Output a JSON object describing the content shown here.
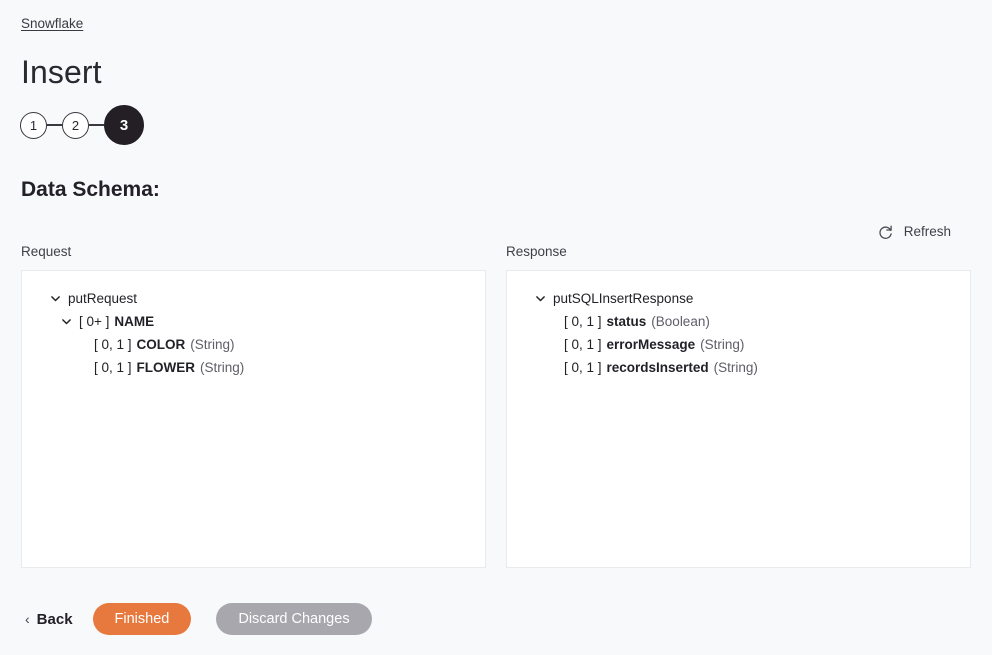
{
  "breadcrumb": {
    "label": "Snowflake"
  },
  "header": {
    "title": "Insert"
  },
  "stepper": {
    "steps": [
      {
        "label": "1",
        "active": false
      },
      {
        "label": "2",
        "active": false
      },
      {
        "label": "3",
        "active": true
      }
    ]
  },
  "section": {
    "heading": "Data Schema:"
  },
  "columns": {
    "request_label": "Request",
    "response_label": "Response"
  },
  "refresh": {
    "label": "Refresh",
    "icon": "refresh-icon"
  },
  "request_tree": {
    "nodes": [
      {
        "depth": 0,
        "chevron": "chevron-down-icon",
        "occurs": "",
        "name": "putRequest",
        "type": "",
        "bold": false
      },
      {
        "depth": 1,
        "chevron": "chevron-down-icon",
        "occurs": "[ 0+ ]",
        "name": "NAME",
        "type": "",
        "bold": true
      },
      {
        "depth": 2,
        "chevron": "",
        "occurs": "[ 0, 1 ]",
        "name": "COLOR",
        "type": "(String)",
        "bold": true
      },
      {
        "depth": 2,
        "chevron": "",
        "occurs": "[ 0, 1 ]",
        "name": "FLOWER",
        "type": "(String)",
        "bold": true
      }
    ]
  },
  "response_tree": {
    "nodes": [
      {
        "depth": 0,
        "chevron": "chevron-down-icon",
        "occurs": "",
        "name": "putSQLInsertResponse",
        "type": "",
        "bold": false
      },
      {
        "depth": 1,
        "chevron": "",
        "occurs": "[ 0, 1 ]",
        "name": "status",
        "type": "(Boolean)",
        "bold": true
      },
      {
        "depth": 1,
        "chevron": "",
        "occurs": "[ 0, 1 ]",
        "name": "errorMessage",
        "type": "(String)",
        "bold": true
      },
      {
        "depth": 1,
        "chevron": "",
        "occurs": "[ 0, 1 ]",
        "name": "recordsInserted",
        "type": "(String)",
        "bold": true
      }
    ]
  },
  "footer": {
    "back_label": "Back",
    "back_chevron": "‹",
    "finished_label": "Finished",
    "discard_label": "Discard Changes"
  },
  "colors": {
    "accent_orange": "#e8793e",
    "neutral_gray": "#a7a7ad",
    "active_step": "#231f25",
    "page_background": "#f8f9fb",
    "panel_background": "#ffffff",
    "panel_border": "#e9eaee"
  }
}
